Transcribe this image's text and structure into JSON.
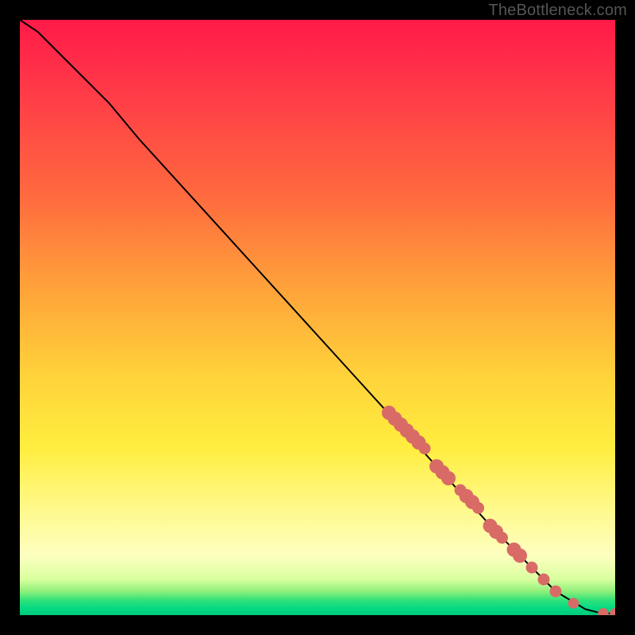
{
  "watermark": "TheBottleneck.com",
  "chart_data": {
    "type": "line",
    "title": "",
    "xlabel": "",
    "ylabel": "",
    "xlim": [
      0,
      100
    ],
    "ylim": [
      0,
      100
    ],
    "series": [
      {
        "name": "curve",
        "x": [
          0,
          3,
          6,
          10,
          15,
          20,
          30,
          40,
          50,
          60,
          70,
          80,
          90,
          95,
          97,
          98,
          100
        ],
        "y": [
          100,
          98,
          95,
          91,
          86,
          80,
          69,
          58,
          47,
          36,
          25,
          14,
          4,
          1,
          0.5,
          0.3,
          0.3
        ]
      }
    ],
    "markers": {
      "name": "highlighted-points",
      "color": "#d96b67",
      "points": [
        {
          "x": 62,
          "y": 34,
          "r": 1.2
        },
        {
          "x": 63,
          "y": 33,
          "r": 1.2
        },
        {
          "x": 64,
          "y": 32,
          "r": 1.2
        },
        {
          "x": 65,
          "y": 31,
          "r": 1.2
        },
        {
          "x": 66,
          "y": 30,
          "r": 1.2
        },
        {
          "x": 67,
          "y": 29,
          "r": 1.2
        },
        {
          "x": 68,
          "y": 28,
          "r": 1.0
        },
        {
          "x": 70,
          "y": 25,
          "r": 1.2
        },
        {
          "x": 71,
          "y": 24,
          "r": 1.2
        },
        {
          "x": 72,
          "y": 23,
          "r": 1.2
        },
        {
          "x": 74,
          "y": 21,
          "r": 1.0
        },
        {
          "x": 75,
          "y": 20,
          "r": 1.2
        },
        {
          "x": 76,
          "y": 19,
          "r": 1.2
        },
        {
          "x": 77,
          "y": 18,
          "r": 1.0
        },
        {
          "x": 79,
          "y": 15,
          "r": 1.2
        },
        {
          "x": 80,
          "y": 14,
          "r": 1.2
        },
        {
          "x": 81,
          "y": 13,
          "r": 1.0
        },
        {
          "x": 83,
          "y": 11,
          "r": 1.2
        },
        {
          "x": 84,
          "y": 10,
          "r": 1.2
        },
        {
          "x": 86,
          "y": 8,
          "r": 1.0
        },
        {
          "x": 88,
          "y": 6,
          "r": 1.0
        },
        {
          "x": 90,
          "y": 4,
          "r": 1.0
        },
        {
          "x": 93,
          "y": 2,
          "r": 0.9
        },
        {
          "x": 98,
          "y": 0.3,
          "r": 0.9
        },
        {
          "x": 100,
          "y": 0.3,
          "r": 0.9
        }
      ]
    },
    "background_gradient": {
      "top": "#ff1a48",
      "mid1": "#ffa23a",
      "mid2": "#ffee3f",
      "bottom": "#00c87a"
    }
  }
}
